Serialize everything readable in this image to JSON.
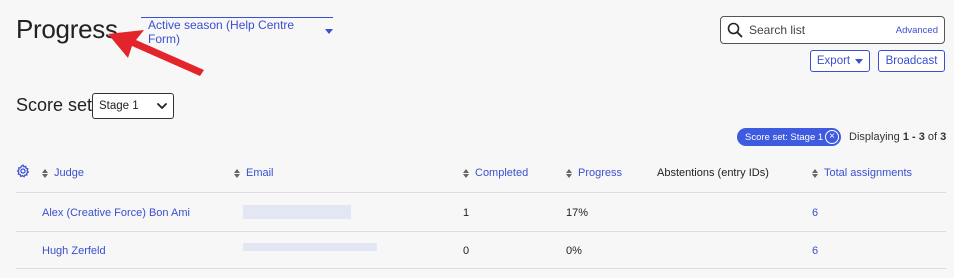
{
  "header": {
    "title": "Progress",
    "season": "Active season (Help Centre Form)"
  },
  "search": {
    "placeholder": "Search list",
    "advanced": "Advanced"
  },
  "toolbar": {
    "export": "Export",
    "broadcast": "Broadcast"
  },
  "score_set": {
    "label": "Score set",
    "selected": "Stage 1"
  },
  "filter": {
    "pill": "Score set: Stage 1",
    "displaying_prefix": "Displaying",
    "range": "1 - 3",
    "of_word": "of",
    "total": "3"
  },
  "table": {
    "columns": [
      "Judge",
      "Email",
      "Completed",
      "Progress",
      "Abstentions (entry IDs)",
      "Total assignments"
    ],
    "rows": [
      {
        "judge": "Alex (Creative Force) Bon Ami",
        "email": "",
        "completed": "1",
        "progress": "17%",
        "abstentions": "",
        "total": "6"
      },
      {
        "judge": "Hugh Zerfeld",
        "email": "",
        "completed": "0",
        "progress": "0%",
        "abstentions": "",
        "total": "6"
      }
    ]
  },
  "colors": {
    "accent": "#3a4fd1",
    "pill": "#3d5ae0",
    "annotation_arrow": "#e3242b"
  },
  "icons": [
    "search-icon",
    "gear-icon",
    "sort-icon",
    "chevron-down-icon",
    "close-circle-icon",
    "annotation-arrow-icon"
  ]
}
